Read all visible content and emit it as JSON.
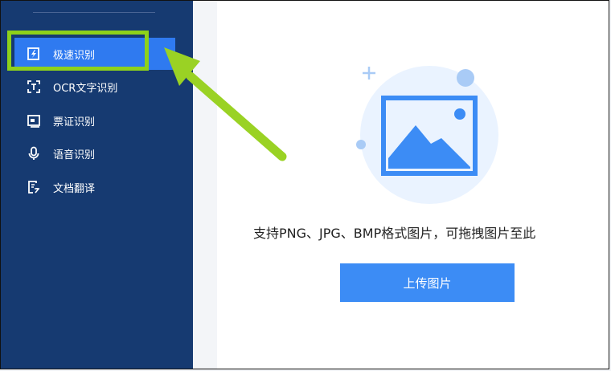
{
  "sidebar": {
    "items": [
      {
        "label": "极速识别",
        "icon": "lightning-doc-icon",
        "active": true
      },
      {
        "label": "OCR文字识别",
        "icon": "text-scan-icon",
        "active": false
      },
      {
        "label": "票证识别",
        "icon": "id-card-icon",
        "active": false
      },
      {
        "label": "语音识别",
        "icon": "microphone-icon",
        "active": false
      },
      {
        "label": "文档翻译",
        "icon": "doc-translate-icon",
        "active": false
      }
    ]
  },
  "main": {
    "hint": "支持PNG、JPG、BMP格式图片，可拖拽图片至此",
    "upload_button": "上传图片",
    "illustration": "image-placeholder-icon"
  },
  "colors": {
    "sidebar_bg": "#163a71",
    "active_item": "#2f7af0",
    "highlight": "#8ed11a",
    "button": "#3c8cf5"
  }
}
